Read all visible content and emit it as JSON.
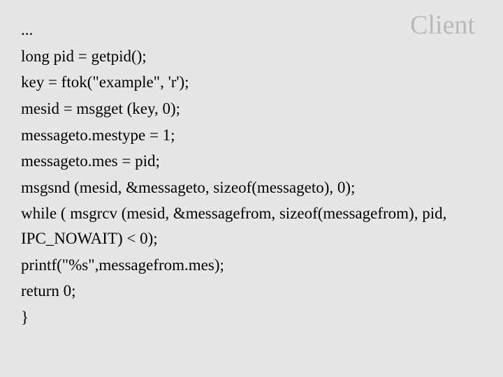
{
  "title": "Client",
  "lines": {
    "l0": "...",
    "l1": "long pid = getpid();",
    "l2": "key = ftok(\"example\", 'r');",
    "l3": "mesid = msgget (key, 0);",
    "l4": "messageto.mestype = 1;",
    "l5": "messageto.mes = pid;",
    "l6": "msgsnd (mesid, &messageto, sizeof(messageto), 0);",
    "l7": "while ( msgrcv (mesid, &messagefrom, sizeof(messagefrom),  pid,  IPC_NOWAIT)  <  0);",
    "l8": "printf(\"%s\",messagefrom.mes);",
    "l9": "return 0;",
    "l10": "}"
  }
}
